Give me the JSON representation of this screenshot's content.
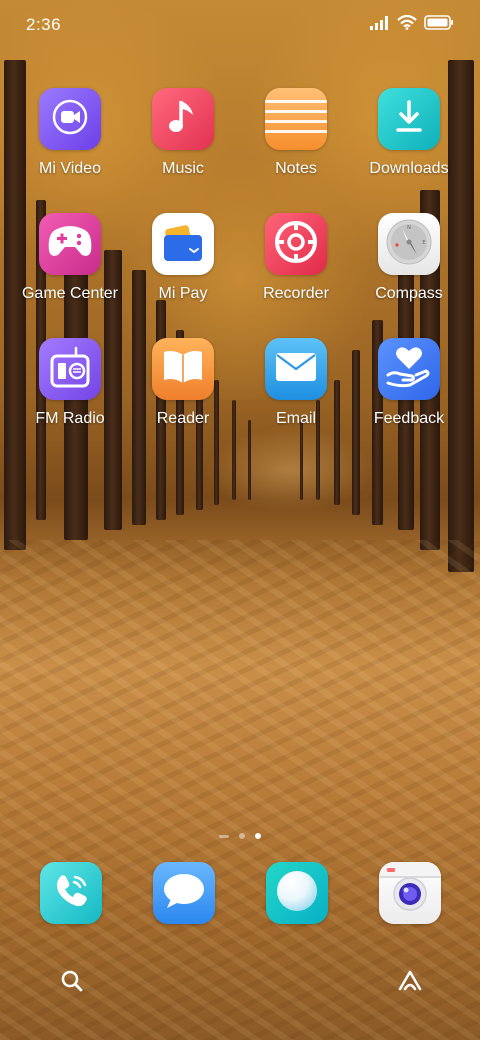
{
  "status_bar": {
    "time": "2:36"
  },
  "apps": [
    {
      "label": "Mi Video",
      "icon": "video-camera-icon",
      "color": "#7b5cf0"
    },
    {
      "label": "Music",
      "icon": "music-note-icon",
      "color": "#f04868"
    },
    {
      "label": "Notes",
      "icon": "notes-lines-icon",
      "color": "#f7a043"
    },
    {
      "label": "Downloads",
      "icon": "download-arrow-icon",
      "color": "#17c3c6"
    },
    {
      "label": "Game Center",
      "icon": "gamepad-icon",
      "color": "#e23fa0"
    },
    {
      "label": "Mi Pay",
      "icon": "wallet-icon",
      "color": "#ffffff"
    },
    {
      "label": "Recorder",
      "icon": "record-dial-icon",
      "color": "#f03b5a"
    },
    {
      "label": "Compass",
      "icon": "compass-icon",
      "color": "#f2f2f2"
    },
    {
      "label": "FM Radio",
      "icon": "radio-icon",
      "color": "#8d5cf2"
    },
    {
      "label": "Reader",
      "icon": "open-book-icon",
      "color": "#f4923a"
    },
    {
      "label": "Email",
      "icon": "envelope-icon",
      "color": "#2ea6ec"
    },
    {
      "label": "Feedback",
      "icon": "heart-hand-icon",
      "color": "#3f7ef2"
    }
  ],
  "dock": [
    {
      "name": "Phone",
      "icon": "phone-icon",
      "color": "#2fd2d6"
    },
    {
      "name": "Messages",
      "icon": "chat-bubble-icon",
      "color": "#3d9ff0"
    },
    {
      "name": "Browser",
      "icon": "browser-sphere-icon",
      "color": "#16c6c0"
    },
    {
      "name": "Camera",
      "icon": "camera-icon",
      "color": "#ffffff"
    }
  ],
  "page_indicator": {
    "pages": 2,
    "active": 2
  }
}
